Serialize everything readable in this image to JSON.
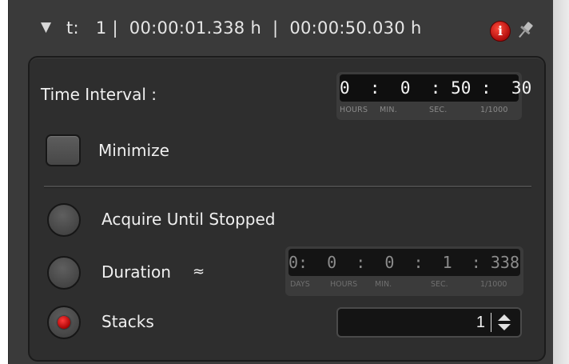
{
  "header": {
    "collapse_icon": "triangle-down-icon",
    "text": "t:   1 |  00:00:01.338 h  |  00:00:50.030 h",
    "info_icon_glyph": "i",
    "pin_icon": "pin-icon"
  },
  "time_interval": {
    "label": "Time Interval :",
    "display": "0  :  0  : 50 :  30",
    "units": [
      "HOURS",
      "MIN.",
      "SEC.",
      "1/1000"
    ]
  },
  "minimize": {
    "label": "Minimize",
    "checked": false
  },
  "acquire_mode": {
    "options": [
      {
        "label": "Acquire Until Stopped",
        "selected": false
      },
      {
        "label": "Duration",
        "selected": false,
        "suffix": "≈"
      },
      {
        "label": "Stacks",
        "selected": true
      }
    ]
  },
  "duration": {
    "display": "0:  0  :  0  :  1  : 338",
    "units": [
      "DAYS",
      "HOURS",
      "MIN.",
      "SEC.",
      "1/1000"
    ],
    "enabled": false
  },
  "stacks": {
    "value": "1"
  },
  "colors": {
    "panel_bg": "#2e2e2e",
    "accent_red": "#cc0000"
  }
}
